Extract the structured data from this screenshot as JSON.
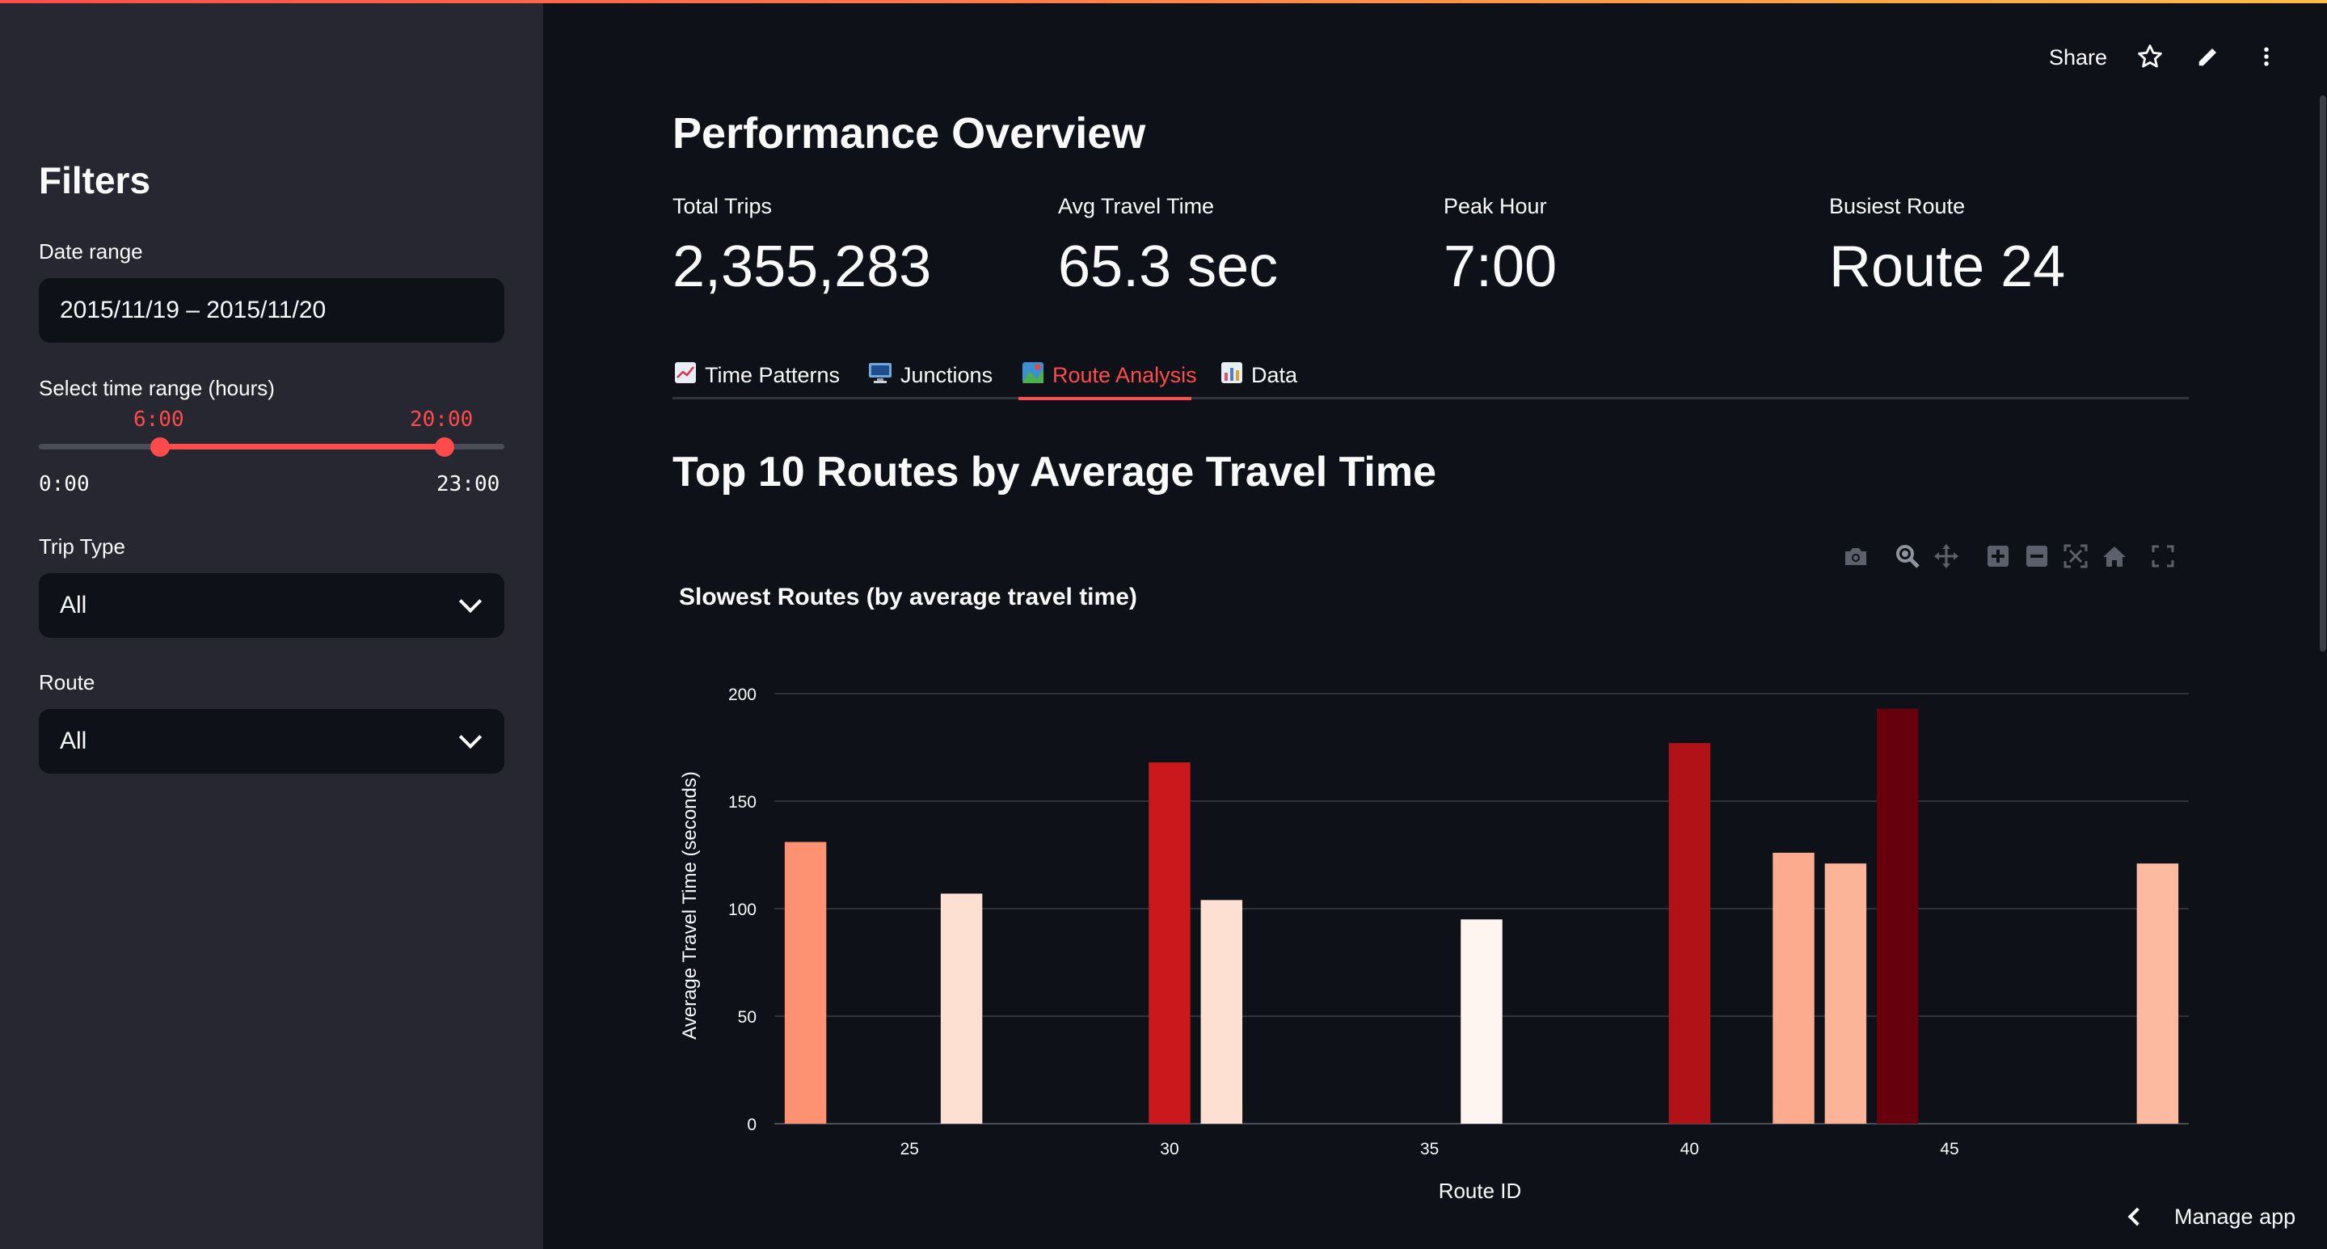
{
  "sidebar": {
    "title": "Filters",
    "date_range": {
      "label": "Date range",
      "value": "2015/11/19 – 2015/11/20"
    },
    "time_range": {
      "label": "Select time range (hours)",
      "low": "6:00",
      "high": "20:00",
      "min": "0:00",
      "max": "23:00",
      "low_value": 6,
      "high_value": 20,
      "min_value": 0,
      "max_value": 23
    },
    "trip_type": {
      "label": "Trip Type",
      "value": "All"
    },
    "route": {
      "label": "Route",
      "value": "All"
    }
  },
  "header": {
    "share_label": "Share",
    "icons": [
      "star-icon",
      "pencil-icon",
      "more-vertical-icon"
    ]
  },
  "main": {
    "title": "Performance Overview",
    "metrics": [
      {
        "label": "Total Trips",
        "value": "2,355,283"
      },
      {
        "label": "Avg Travel Time",
        "value": "65.3 sec"
      },
      {
        "label": "Peak Hour",
        "value": "7:00"
      },
      {
        "label": "Busiest Route",
        "value": "Route 24"
      }
    ],
    "tabs": [
      {
        "label": "Time Patterns",
        "icon": "chart-up-icon",
        "active": false
      },
      {
        "label": "Junctions",
        "icon": "monitor-icon",
        "active": false
      },
      {
        "label": "Route Analysis",
        "icon": "map-icon",
        "active": true
      },
      {
        "label": "Data",
        "icon": "bar-chart-icon",
        "active": false
      }
    ],
    "section_title": "Top 10 Routes by Average Travel Time",
    "modebar_icons": [
      "camera-icon",
      "zoom-icon",
      "pan-icon",
      "zoom-in-icon",
      "zoom-out-icon",
      "autoscale-icon",
      "reset-axes-icon",
      "fullscreen-icon"
    ]
  },
  "chart_data": {
    "type": "bar",
    "title": "Slowest Routes (by average travel time)",
    "xlabel": "Route ID",
    "ylabel": "Average Travel Time (seconds)",
    "x": [
      23,
      26,
      30,
      31,
      36,
      40,
      42,
      43,
      44,
      49
    ],
    "values": [
      131,
      107,
      168,
      104,
      95,
      177,
      126,
      121,
      193,
      121
    ],
    "colors": [
      "#fc9272",
      "#fee0d2",
      "#cb181d",
      "#fee0d2",
      "#fff5f0",
      "#b11218",
      "#fcab8f",
      "#fcb499",
      "#67000d",
      "#fcbba1"
    ],
    "xticks": [
      25,
      30,
      35,
      40,
      45
    ],
    "yticks": [
      0,
      50,
      100,
      150,
      200
    ],
    "xlim": [
      22.4,
      49.6
    ],
    "ylim": [
      0,
      200
    ],
    "grid": true,
    "legend": "none"
  },
  "footer": {
    "manage_app": "Manage app"
  }
}
